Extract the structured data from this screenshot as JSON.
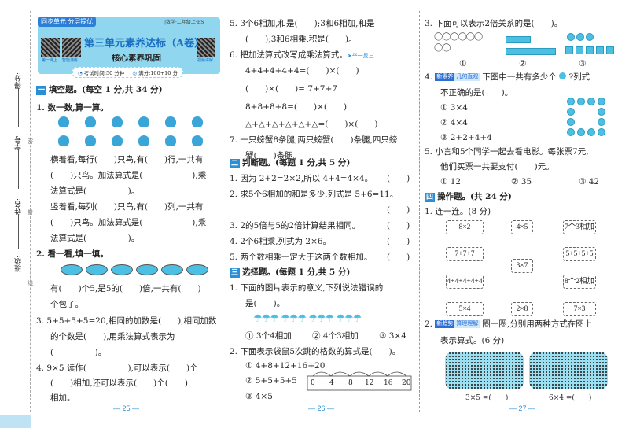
{
  "margin": {
    "labels": [
      "得分:",
      "学号:",
      "姓名:",
      "班级:"
    ],
    "seal": [
      "密",
      "封",
      "线"
    ]
  },
  "header": {
    "series": "同步单元 分层提优",
    "subject": "|数学·二年级上·BS",
    "title": "第三单元素养达标（A卷）",
    "subtitle": "核心素养巩固",
    "qr_left1": "第一课上",
    "qr_left2": "智能测练",
    "qr_right": "视频讲解",
    "time": "考试时间:50 分钟",
    "score": "满分:100+10 分"
  },
  "col1": {
    "sec_num": "一",
    "sec_title": "填空题。(每空 1 分,共 34 分)",
    "lines": [
      "1. 数一数,算一算。",
      "横着看,每行(　　)只鸟,有(　　)行,一共有",
      "(　　)只鸟。加法算式是(　　　　　　),乘",
      "法算式是(　　　　　)。",
      "竖着看,每列(　　)只鸟,有(　　)列,一共有",
      "(　　)只鸟。加法算式是(　　　　　　),乘",
      "法算式是(　　　　　)。",
      "2. 看一看,填一填。",
      "有(　　)个5,是5的(　　)倍,一共有(　　)",
      "个包子。",
      "3. 5+5+5+5=20,相同的加数是(　　),相同加数",
      "的个数是(　　),用乘法算式表示为",
      "(　　　　　)。",
      "4. 9×5 读作(　　　　　),可以表示(　　)个",
      "(　　)相加,还可以表示(　　)个(　　)",
      "相加。"
    ],
    "page": "— 25 —"
  },
  "col2": {
    "lines_a": [
      "5. 3个6相加,和是(　　);3和6相加,和是",
      "(　　);3和6相乘,积是(　　)。",
      "6. 把加法算式改写成乘法算式。",
      "4+4+4+4+4=(　　)×(　　)",
      "(　　)×(　　)= 7+7+7",
      "8+8+8+8=(　　)×(　　)",
      "△+△+△+△+△+△=(　　)×(　　)",
      "7. 一只螃蟹8条腿,两只螃蟹(　　)条腿,四只螃",
      "蟹(　　)条腿。"
    ],
    "link": "➤举一反三",
    "sec2_num": "二",
    "sec2_title": "判断题。(每题 1 分,共 5 分)",
    "judge": [
      "1. 因为 2+2=2×2,所以 4+4=4×4。",
      "2. 求5个6相加的和是多少,列式是 5+6=11。",
      "",
      "3. 2的5倍与5的2倍计算结果相同。",
      "4. 2个6相乘,列式为 2×6。",
      "5. 两个数相乘一定大于这两个数相加。"
    ],
    "paren": "(　　)",
    "sec3_num": "三",
    "sec3_title": "选择题。(每题 1 分,共 5 分)",
    "lines_b": [
      "1. 下面的图片表示的意义,下列说法错误的",
      "是(　　)。"
    ],
    "q1_opts": [
      "① 3个4相加",
      "② 4个3相加",
      "③ 3×4"
    ],
    "q2": "2. 下面表示袋鼠5次跳的格数的算式是(　　)。",
    "q2_opts": [
      "① 4+8+12+16+20",
      "② 5+5+5+5",
      "③ 4×5"
    ],
    "ticks": [
      "0",
      "4",
      "8",
      "12",
      "16",
      "20"
    ],
    "page": "— 26 —"
  },
  "col3": {
    "q3": "3. 下面可以表示2倍关系的是(　　)。",
    "q3_opts": [
      "①",
      "②",
      "③"
    ],
    "q4_tag1": "新素养",
    "q4_tag2": "几何直观",
    "q4a": "下图中一共有多少个",
    "q4b": "?列式",
    "q4c": "不正确的是(　　)。",
    "q4_opts": [
      "① 3×4",
      "② 4×4",
      "③ 2+2+4+4"
    ],
    "q5a": "5. 小言和5个同学一起去看电影。每张票7元,",
    "q5b": "他们买票一共要支付(　　)元。",
    "q5_opts": [
      "① 12",
      "② 35",
      "③ 42"
    ],
    "sec4_num": "四",
    "sec4_title": "操作题。(共 24 分)",
    "m1": "1. 连一连。(8 分)",
    "match": {
      "left": [
        "8×2",
        "7+7+7",
        "4+4+4+4+4",
        "5×4"
      ],
      "mid": [
        "4×5",
        "3×7",
        "2×8"
      ],
      "right": [
        "7个3相加",
        "5+5+5+5",
        "8个2相加",
        "7×3"
      ]
    },
    "m2_tag1": "新趋势",
    "m2_tag2": "算理理解",
    "m2a": "圈一圈,分别用两种方式在图上",
    "m2b": "表示算式。(6 分)",
    "eq1": "3×5 =(　　)",
    "eq2": "6×4 =(　　)",
    "page": "— 27 —"
  }
}
